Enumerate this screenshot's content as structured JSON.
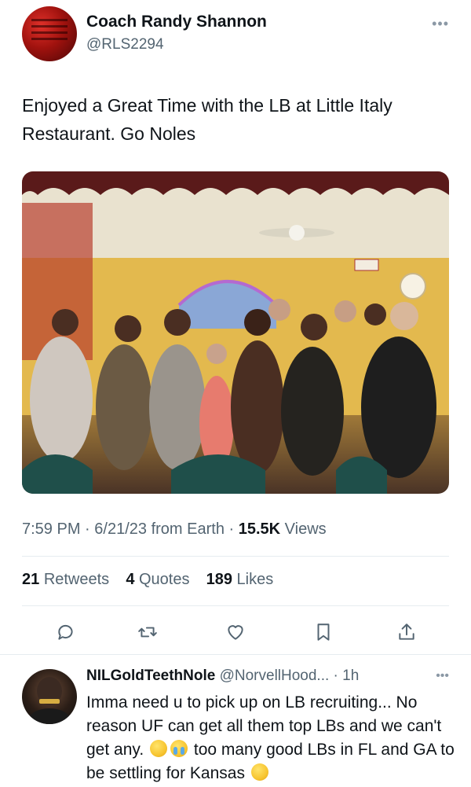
{
  "author": {
    "name": "Coach Randy Shannon",
    "handle": "@RLS2294"
  },
  "tweet": {
    "text": "Enjoyed a Great Time with the LB at Little Italy Restaurant. Go Noles",
    "time": "7:59 PM",
    "date": "6/21/23",
    "source": "from Earth",
    "views_count": "15.5K",
    "views_label": "Views",
    "sep": "·"
  },
  "stats": {
    "retweets_count": "21",
    "retweets_label": "Retweets",
    "quotes_count": "4",
    "quotes_label": "Quotes",
    "likes_count": "189",
    "likes_label": "Likes"
  },
  "icons": {
    "more": "more-icon",
    "reply": "reply-icon",
    "retweet": "retweet-icon",
    "like": "heart-icon",
    "bookmark": "bookmark-icon",
    "share": "share-icon"
  },
  "reply": {
    "name": "NILGoldTeethNole",
    "handle": "@NorvellHood...",
    "time": "1h",
    "sep": "·",
    "text_part1": "Imma need u to pick up on LB recruiting... No reason UF can get all them top LBs and we can't get any.",
    "text_part2": "too many good LBs in FL and GA to be settling for Kansas"
  },
  "colors": {
    "accent": "#1d9bf0",
    "muted": "#536471",
    "text": "#0f1419"
  }
}
